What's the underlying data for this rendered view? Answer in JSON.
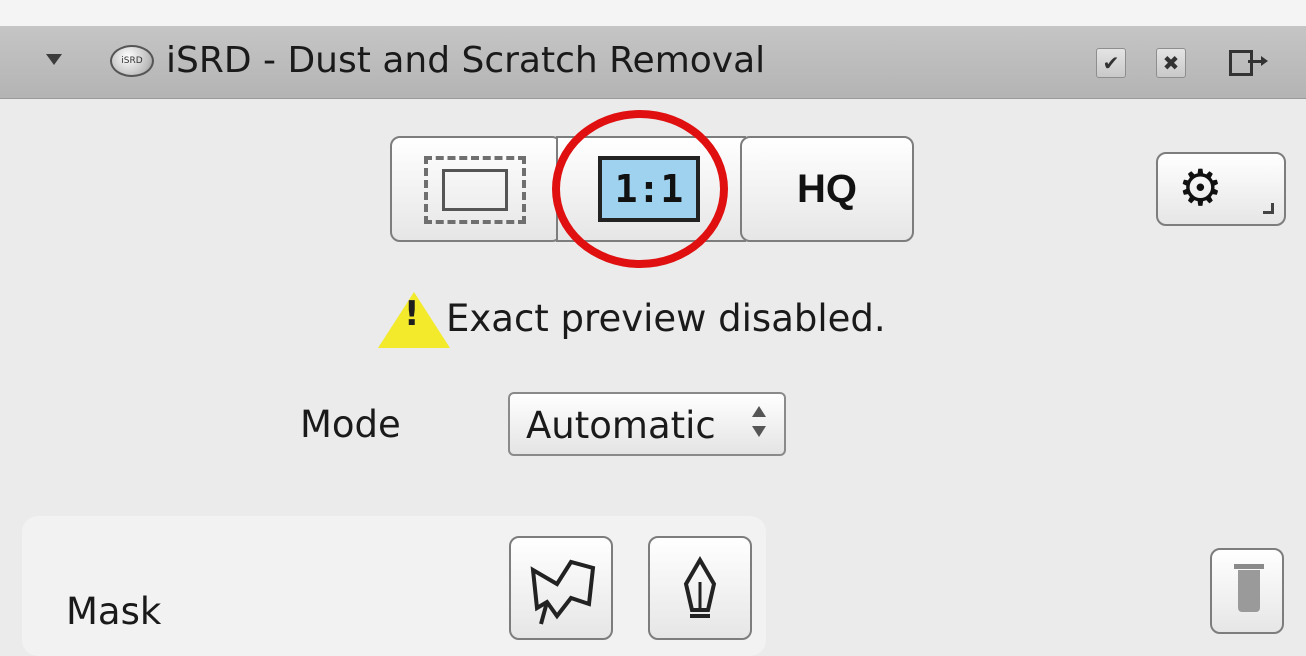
{
  "titlebar": {
    "title": "iSRD - Dust and Scratch Removal",
    "logo_text": "iSRD",
    "icons": [
      "collapse-arrow-icon",
      "check-icon",
      "close-icon",
      "exit-icon"
    ]
  },
  "preview": {
    "frame_icon": "dashed-frame-icon",
    "one_to_one_label": "1:1",
    "hq_label": "HQ",
    "settings_icon": "gear-icon",
    "highlight_color": "#e01010",
    "one_to_one_color": "#9fd2ee"
  },
  "warning": {
    "icon": "warning-icon",
    "mark": "!",
    "text": "Exact preview disabled."
  },
  "mode": {
    "label": "Mode",
    "value": "Automatic"
  },
  "mask": {
    "label": "Mask",
    "buttons": [
      "mask-draw-icon",
      "pen-icon"
    ],
    "trash_icon": "trash-icon"
  }
}
